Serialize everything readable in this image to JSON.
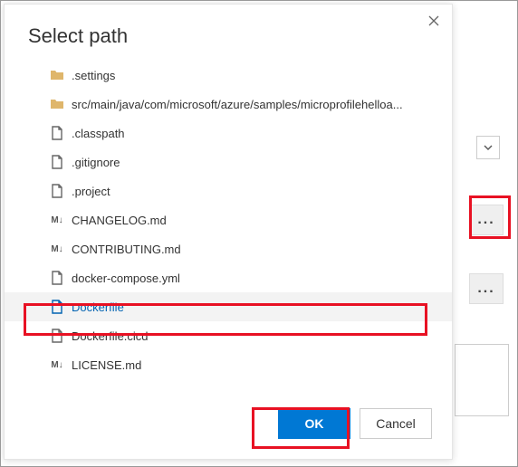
{
  "dialog": {
    "title": "Select path",
    "ok_label": "OK",
    "cancel_label": "Cancel"
  },
  "items": [
    {
      "type": "folder",
      "name": ".settings"
    },
    {
      "type": "folder",
      "name": "src/main/java/com/microsoft/azure/samples/microprofilehelloa..."
    },
    {
      "type": "file",
      "name": ".classpath"
    },
    {
      "type": "file",
      "name": ".gitignore"
    },
    {
      "type": "file",
      "name": ".project"
    },
    {
      "type": "md",
      "name": "CHANGELOG.md"
    },
    {
      "type": "md",
      "name": "CONTRIBUTING.md"
    },
    {
      "type": "file",
      "name": "docker-compose.yml"
    },
    {
      "type": "file",
      "name": "Dockerfile",
      "selected": true
    },
    {
      "type": "file",
      "name": "Dockerfile.cicd"
    },
    {
      "type": "md",
      "name": "LICENSE.md"
    }
  ],
  "background": {
    "ellipsis": "..."
  }
}
